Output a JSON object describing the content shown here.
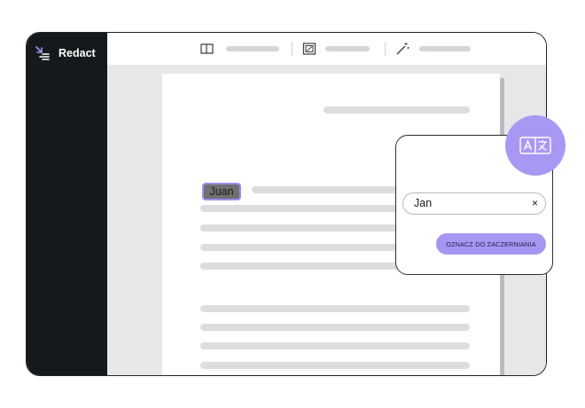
{
  "app": {
    "name": "Redact"
  },
  "toolbar": {
    "icons": [
      "book-icon",
      "image-redact-icon",
      "magic-wand-icon"
    ]
  },
  "document": {
    "highlighted_entity": "Juan"
  },
  "replace_popup": {
    "input_value": "Jan",
    "clear_label": "×",
    "action_label": "OZNACZ DO ZACZERNIANIA"
  },
  "colors": {
    "sidebar": "#16191c",
    "accent": "#a696f2",
    "workspace": "#e6e7e8",
    "placeholder": "#dcdddf"
  }
}
